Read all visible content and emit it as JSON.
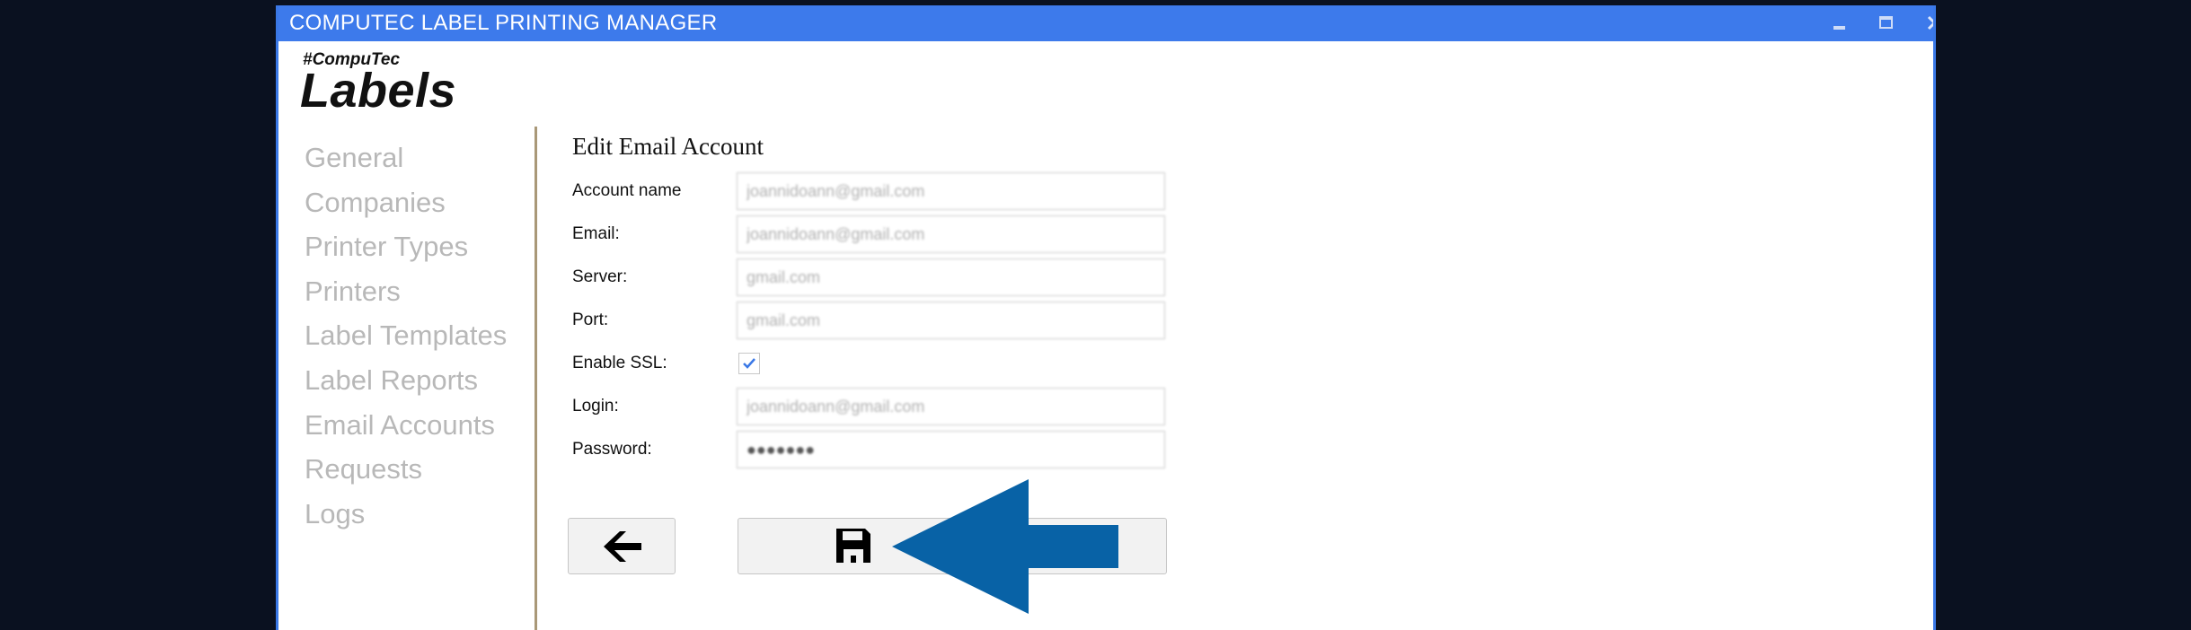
{
  "window": {
    "title": "COMPUTEC LABEL PRINTING MANAGER"
  },
  "logo": {
    "tag": "#CompuTec",
    "name": "Labels"
  },
  "nav": {
    "items": [
      {
        "label": "General"
      },
      {
        "label": "Companies"
      },
      {
        "label": "Printer Types"
      },
      {
        "label": "Printers"
      },
      {
        "label": "Label Templates"
      },
      {
        "label": "Label Reports"
      },
      {
        "label": "Email Accounts"
      },
      {
        "label": "Requests"
      },
      {
        "label": "Logs"
      }
    ]
  },
  "form": {
    "title": "Edit Email Account",
    "account_name": {
      "label": "Account name",
      "value": "joannidoann@gmail.com"
    },
    "email": {
      "label": "Email:",
      "value": "joannidoann@gmail.com"
    },
    "server": {
      "label": "Server:",
      "value": "gmail.com"
    },
    "port": {
      "label": "Port:",
      "value": "gmail.com"
    },
    "enable_ssl": {
      "label": "Enable SSL:",
      "checked": true
    },
    "login": {
      "label": "Login:",
      "value": "joannidoann@gmail.com"
    },
    "password": {
      "label": "Password:",
      "value": "●●●●●●●"
    }
  },
  "buttons": {
    "back_icon": "arrow-left-icon",
    "save_icon": "floppy-disk-icon"
  },
  "colors": {
    "titlebar": "#3d7aeb",
    "nav_text": "#b8b8b8",
    "annotation_arrow": "#0862a6"
  }
}
